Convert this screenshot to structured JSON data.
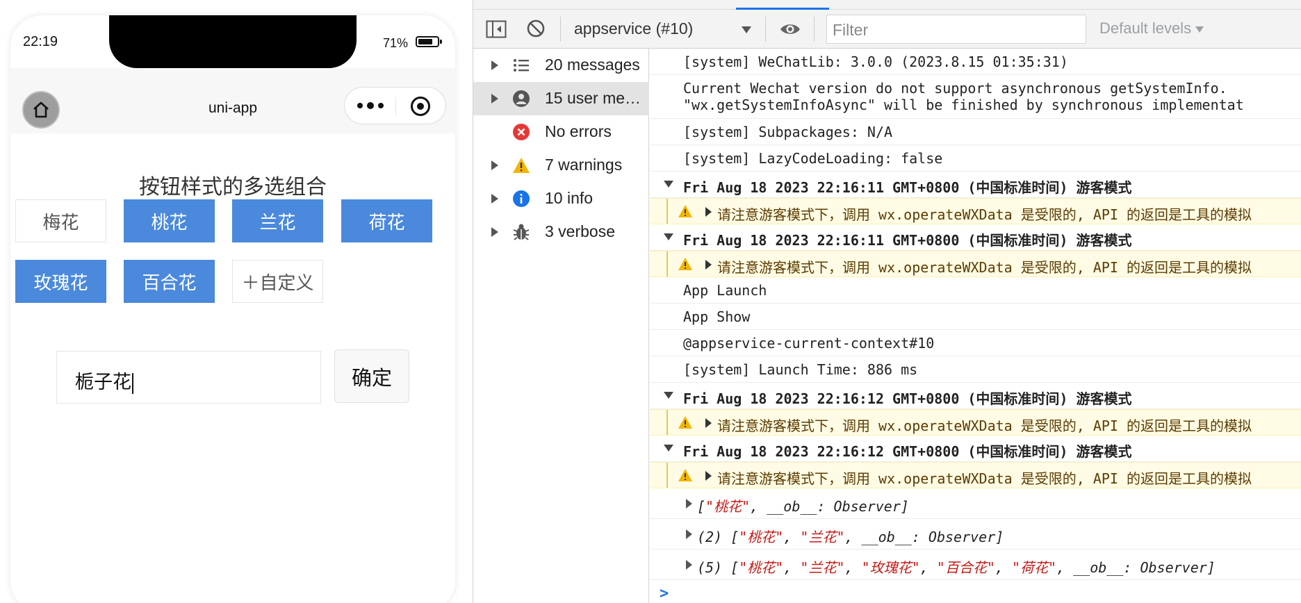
{
  "simulator": {
    "status_time": "22:19",
    "battery_pct": "71%",
    "nav_title": "uni-app",
    "heading": "按钮样式的多选组合",
    "chips": [
      {
        "label": "梅花",
        "selected": false
      },
      {
        "label": "桃花",
        "selected": true
      },
      {
        "label": "兰花",
        "selected": true
      },
      {
        "label": "荷花",
        "selected": true
      },
      {
        "label": "玫瑰花",
        "selected": true
      },
      {
        "label": "百合花",
        "selected": true
      },
      {
        "label": "＋自定义",
        "selected": false
      }
    ],
    "custom_input_value": "栀子花",
    "confirm_label": "确定",
    "colors": {
      "selected": "#4a89dc",
      "unselected_border": "#e4e4e4"
    }
  },
  "devtools": {
    "context": "appservice (#10)",
    "filter_placeholder": "Filter",
    "levels": "Default levels",
    "sidebar": [
      {
        "label": "20 messages",
        "icon": "list-icon"
      },
      {
        "label": "15 user me…",
        "icon": "user-icon"
      },
      {
        "label": "No errors",
        "icon": "error-icon"
      },
      {
        "label": "7 warnings",
        "icon": "warning-icon"
      },
      {
        "label": "10 info",
        "icon": "info-icon"
      },
      {
        "label": "3 verbose",
        "icon": "bug-icon"
      }
    ],
    "log": {
      "l1": "[system] WeChatLib: 3.0.0 (2023.8.15 01:35:31)",
      "l2a": "Current Wechat version do not support asynchronous getSystemInfo.",
      "l2b": "\"wx.getSystemInfoAsync\" will be finished by synchronous implementat",
      "l3": "[system] Subpackages: N/A",
      "l4": "[system] LazyCodeLoading: false",
      "g1": "Fri Aug 18 2023 22:16:11 GMT+0800 (中国标准时间) 游客模式",
      "w1": "请注意游客模式下，调用 wx.operateWXData 是受限的, API 的返回是工具的模拟",
      "g2": "Fri Aug 18 2023 22:16:11 GMT+0800 (中国标准时间) 游客模式",
      "w2": "请注意游客模式下，调用 wx.operateWXData 是受限的, API 的返回是工具的模拟",
      "l5": "App Launch",
      "l6": "App Show",
      "l7": "@appservice-current-context#10",
      "l8": "[system] Launch Time: 886 ms",
      "g3": "Fri Aug 18 2023 22:16:12 GMT+0800 (中国标准时间) 游客模式",
      "w3": "请注意游客模式下，调用 wx.operateWXData 是受限的, API 的返回是工具的模拟",
      "g4": "Fri Aug 18 2023 22:16:12 GMT+0800 (中国标准时间) 游客模式",
      "w4": "请注意游客模式下，调用 wx.operateWXData 是受限的, API 的返回是工具的模拟",
      "o1_pre": "[",
      "o1_s1": "\"桃花\"",
      "o1_post": ", __ob__: Observer]",
      "o2_pre": "(2) [",
      "o2_s1": "\"桃花\"",
      "o2_mid": ", ",
      "o2_s2": "\"兰花\"",
      "o2_post": ", __ob__: Observer]",
      "o3_pre": "(5) [",
      "o3_s1": "\"桃花\"",
      "o3_s2": "\"兰花\"",
      "o3_s3": "\"玫瑰花\"",
      "o3_s4": "\"百合花\"",
      "o3_s5": "\"荷花\"",
      "o3_sep": ", ",
      "o3_post": ", __ob__: Observer]",
      "prompt": ">"
    }
  }
}
